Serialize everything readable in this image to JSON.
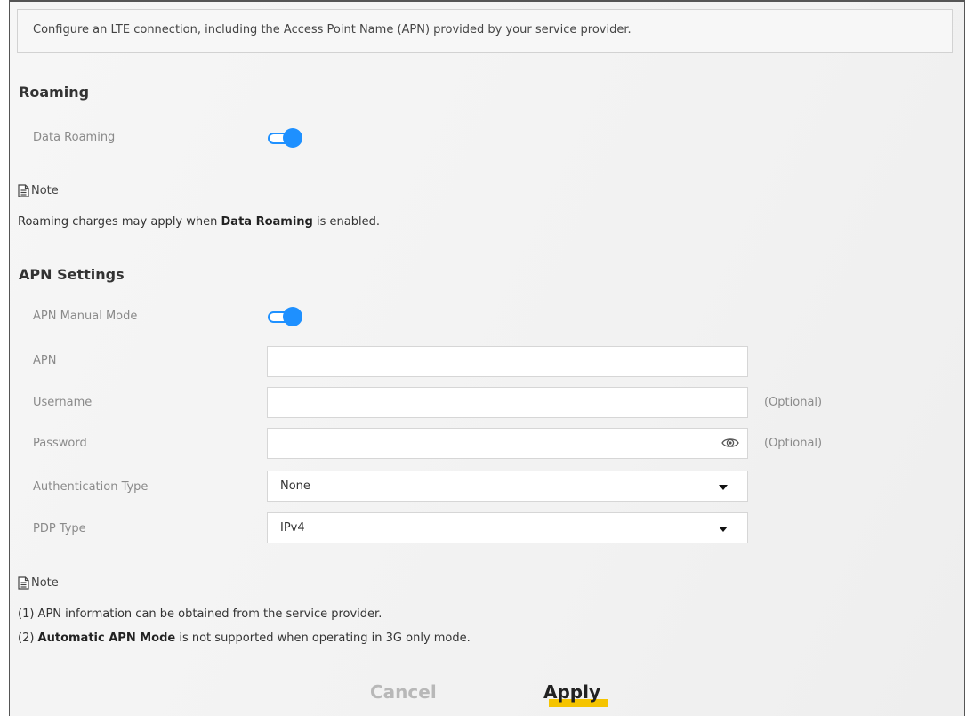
{
  "intro": "Configure an LTE connection, including the Access Point Name (APN) provided by your service provider.",
  "roaming": {
    "title": "Roaming",
    "data_roaming_label": "Data Roaming",
    "data_roaming_enabled": true
  },
  "note1": {
    "heading": "Note",
    "text_before": "Roaming charges may apply when ",
    "text_bold": "Data Roaming",
    "text_after": " is enabled."
  },
  "apn": {
    "title": "APN Settings",
    "manual_mode_label": "APN Manual Mode",
    "manual_mode_enabled": true,
    "apn_label": "APN",
    "apn_value": "",
    "username_label": "Username",
    "username_value": "",
    "username_hint": "(Optional)",
    "password_label": "Password",
    "password_value": "",
    "password_hint": "(Optional)",
    "auth_label": "Authentication Type",
    "auth_value": "None",
    "pdp_label": "PDP Type",
    "pdp_value": "IPv4"
  },
  "note2": {
    "heading": "Note",
    "line1": "(1) APN information can be obtained from the service provider.",
    "line2_prefix": "(2) ",
    "line2_bold": "Automatic APN Mode",
    "line2_after": " is not supported when operating in 3G only mode."
  },
  "buttons": {
    "cancel": "Cancel",
    "apply": "Apply"
  },
  "colors": {
    "toggle_accent": "#1e90ff",
    "apply_highlight": "#f5c400"
  },
  "icons": [
    "note-icon",
    "eye-icon",
    "chevron-down-icon"
  ]
}
